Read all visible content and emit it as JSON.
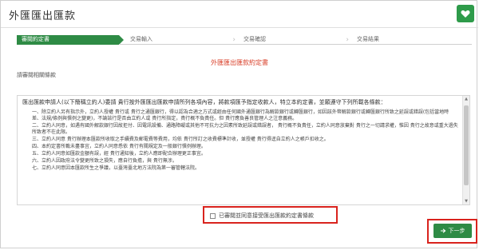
{
  "header": {
    "title": "外匯匯出匯款",
    "icon": "heart-icon"
  },
  "steps": [
    {
      "label": "審閱約定書",
      "active": true
    },
    {
      "label": "交易輸入",
      "active": false
    },
    {
      "label": "交易確認",
      "active": false
    },
    {
      "label": "交易結果",
      "active": false
    }
  ],
  "doc_title": "外匯匯出匯款約定書",
  "read_hint": "請審閱相關條款",
  "terms": {
    "intro": "匯出匯款申請人(以下簡稱立約人)委請 貴行按外匯匯出匯款申請所列各項內容，將款項匯予指定收款人，特立本約定書，並願遵守下列所載各條款：",
    "clauses": [
      "一、除立約人另有指示外，立約人授權 貴行或 貴行之通匯銀行，得以認為合適之方式或經由任何國外通匯銀行為解款銀行或轉匯銀行，如因該外幣解款銀行或轉匯銀行所致之延誤或錯誤(包括當地時差、法規/條例與慣例之變更)，不論該行是否由立約人或 貴行所指定，貴行概不負責任。但 貴行應負善良管理人之注意義務。",
      "二、立約人同意，如遇有國外解款銀行因故拒付、因電訊設備、通路障礙或其他不可抗力之因素所致延誤或錯誤者， 貴行概不負責任，立約人同意放棄對 貴行之一切請求權，惟因 貴行之故意或重大過失所致者不在此限。",
      "三、立約人同意 貴行辦理本匯款所收取之手續費及郵電費等費用，均依 貴行所訂之收費標準計收，並授權 貴行得逕自立約人之帳戶扣收之。",
      "四、本約定書所載未盡事宜，立約人同意悉依 貴行有關規定及一般銀行慣例辦理。",
      "五、立約人同意如匯款金額有誤，經 貴行通知後，立約人應即配合辦理更正事宜。",
      "六、立約人因政府法令變更所致之損失，應自行負擔，與 貴行無涉。",
      "七、立約人同意因本匯款所生之爭議，以臺灣臺北地方法院為第一審管轄法院。"
    ]
  },
  "agree_label": "已審閱並同意接受匯出匯款約定書條款",
  "next_button": {
    "label": "下一步",
    "icon": "arrow-right-icon"
  },
  "colors": {
    "accent": "#2e8b45",
    "highlight": "#d9231d",
    "doc_title": "#d9412b"
  }
}
